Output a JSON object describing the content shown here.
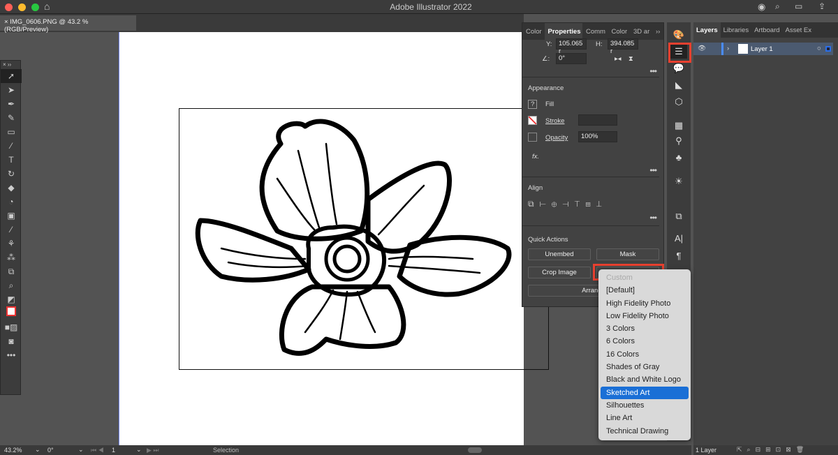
{
  "window": {
    "title": "Adobe Illustrator 2022"
  },
  "document_tab": {
    "label": "IMG_0606.PNG @ 43.2 % (RGB/Preview)"
  },
  "colors": {
    "accent": "#1a6fd6",
    "highlight": "#e8402f"
  },
  "properties": {
    "tabs": [
      "Color",
      "Properties",
      "Comm",
      "Color",
      "3D ar"
    ],
    "y_label": "Y:",
    "y_value": "105.065 r",
    "h_label": "H:",
    "h_value": "394.085 r",
    "rotate_value": "0°",
    "appearance": {
      "title": "Appearance",
      "fill": "Fill",
      "stroke": "Stroke",
      "opacity": "Opacity",
      "opacity_value": "100%",
      "fx": "fx."
    },
    "align": {
      "title": "Align"
    },
    "quick_actions": {
      "title": "Quick Actions",
      "unembed": "Unembed",
      "mask": "Mask",
      "crop": "Crop Image",
      "arrange": "Arrange"
    }
  },
  "trace_menu": {
    "options": [
      "Custom",
      "[Default]",
      "High Fidelity Photo",
      "Low Fidelity Photo",
      "3 Colors",
      "6 Colors",
      "16 Colors",
      "Shades of Gray",
      "Black and White Logo",
      "Sketched Art",
      "Silhouettes",
      "Line Art",
      "Technical Drawing"
    ],
    "selected": "Sketched Art",
    "disabled": "Custom"
  },
  "layers": {
    "tabs": [
      "Layers",
      "Libraries",
      "Artboard",
      "Asset Ex"
    ],
    "layer_name": "Layer 1",
    "count": "1 Layer"
  },
  "status": {
    "zoom": "43.2%",
    "rotation": "0°",
    "artboard": "1",
    "tool": "Selection"
  }
}
